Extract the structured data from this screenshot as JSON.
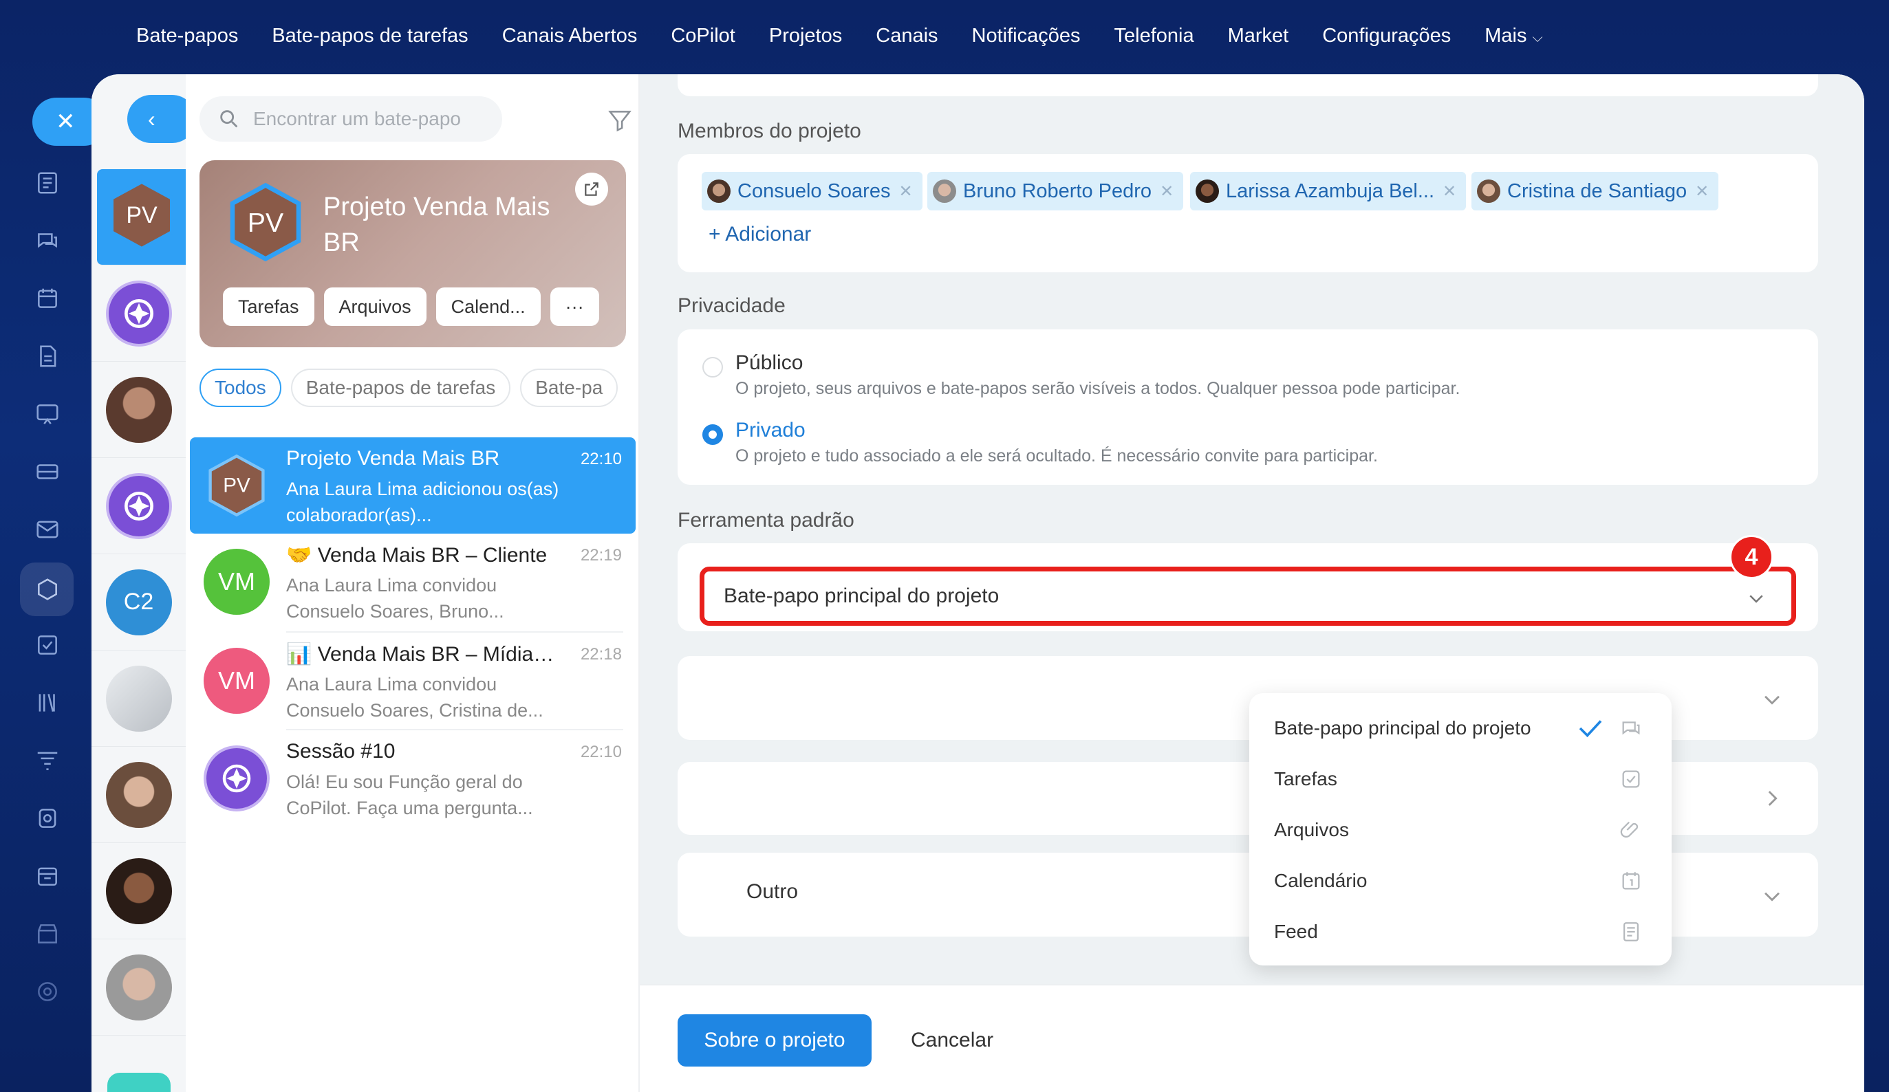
{
  "topnav": {
    "items": [
      "Bate-papos",
      "Bate-papos de tarefas",
      "Canais Abertos",
      "CoPilot",
      "Projetos",
      "Canais",
      "Notificações",
      "Telefonia",
      "Market",
      "Configurações",
      "Mais"
    ]
  },
  "chat_list": {
    "search_placeholder": "Encontrar um bate-papo",
    "project_card": {
      "initials": "PV",
      "title": "Projeto Venda Mais BR",
      "chips": [
        "Tarefas",
        "Arquivos",
        "Calend...",
        "···"
      ]
    },
    "tabs": [
      "Todos",
      "Bate-papos de tarefas",
      "Bate-pa"
    ],
    "items": [
      {
        "initials": "PV",
        "name": "Projeto Venda Mais BR",
        "time": "22:10",
        "message": "Ana Laura Lima adicionou os(as) colaborador(as)...",
        "selected": true,
        "color": "#8a5a48"
      },
      {
        "initials": "VM",
        "emoji": "🤝",
        "name": "Venda Mais BR – Cliente",
        "time": "22:19",
        "message": "Ana Laura Lima convidou Consuelo Soares, Bruno...",
        "selected": false,
        "color": "#55c23b"
      },
      {
        "initials": "VM",
        "emoji": "📊",
        "name": "Venda Mais BR – Mídia ...",
        "time": "22:18",
        "message": "Ana Laura Lima convidou Consuelo Soares, Cristina de...",
        "selected": false,
        "color": "#ee5a7e"
      },
      {
        "initials": "",
        "name": "Sessão #10",
        "time": "22:10",
        "message": "Olá! Eu sou Função geral do CoPilot. Faça uma pergunta...",
        "selected": false,
        "color": "#7b4fd6"
      }
    ]
  },
  "avatar_column": {
    "items": [
      {
        "initials": "PV",
        "color": "#8a5a48"
      },
      {
        "initials": "",
        "color": "#7b4fd6"
      },
      {
        "initials": "",
        "color": "#5a3a2e"
      },
      {
        "initials": "",
        "color": "#7b4fd6"
      },
      {
        "initials": "C2",
        "color": "#2f8fd6"
      },
      {
        "initials": "",
        "color": "#c9ccd0"
      },
      {
        "initials": "",
        "color": "#6b4e3d"
      },
      {
        "initials": "",
        "color": "#3a2a22"
      },
      {
        "initials": "",
        "color": "#8c8c8c"
      }
    ]
  },
  "settings": {
    "members_label": "Membros do projeto",
    "members": [
      "Consuelo Soares",
      "Bruno Roberto Pedro",
      "Larissa Azambuja Bel...",
      "Cristina de Santiago"
    ],
    "add_label": "+ Adicionar",
    "privacy_label": "Privacidade",
    "public_title": "Público",
    "public_desc": "O projeto, seus arquivos e bate-papos serão visíveis a todos. Qualquer pessoa pode participar.",
    "private_title": "Privado",
    "private_desc": "O projeto e tudo associado a ele será ocultado. É necessário convite para participar.",
    "default_tool_label": "Ferramenta padrão",
    "default_tool_value": "Bate-papo principal do projeto",
    "step_badge": "4",
    "other_label": "Outro",
    "dropdown_options": [
      "Bate-papo principal do projeto",
      "Tarefas",
      "Arquivos",
      "Calendário",
      "Feed"
    ],
    "about_button": "Sobre o projeto",
    "cancel_button": "Cancelar"
  },
  "colors": {
    "accent": "#2fa0f5",
    "primary_button": "#1f86e3",
    "highlight_red": "#e8201c",
    "nav_background": "#0b2466"
  }
}
